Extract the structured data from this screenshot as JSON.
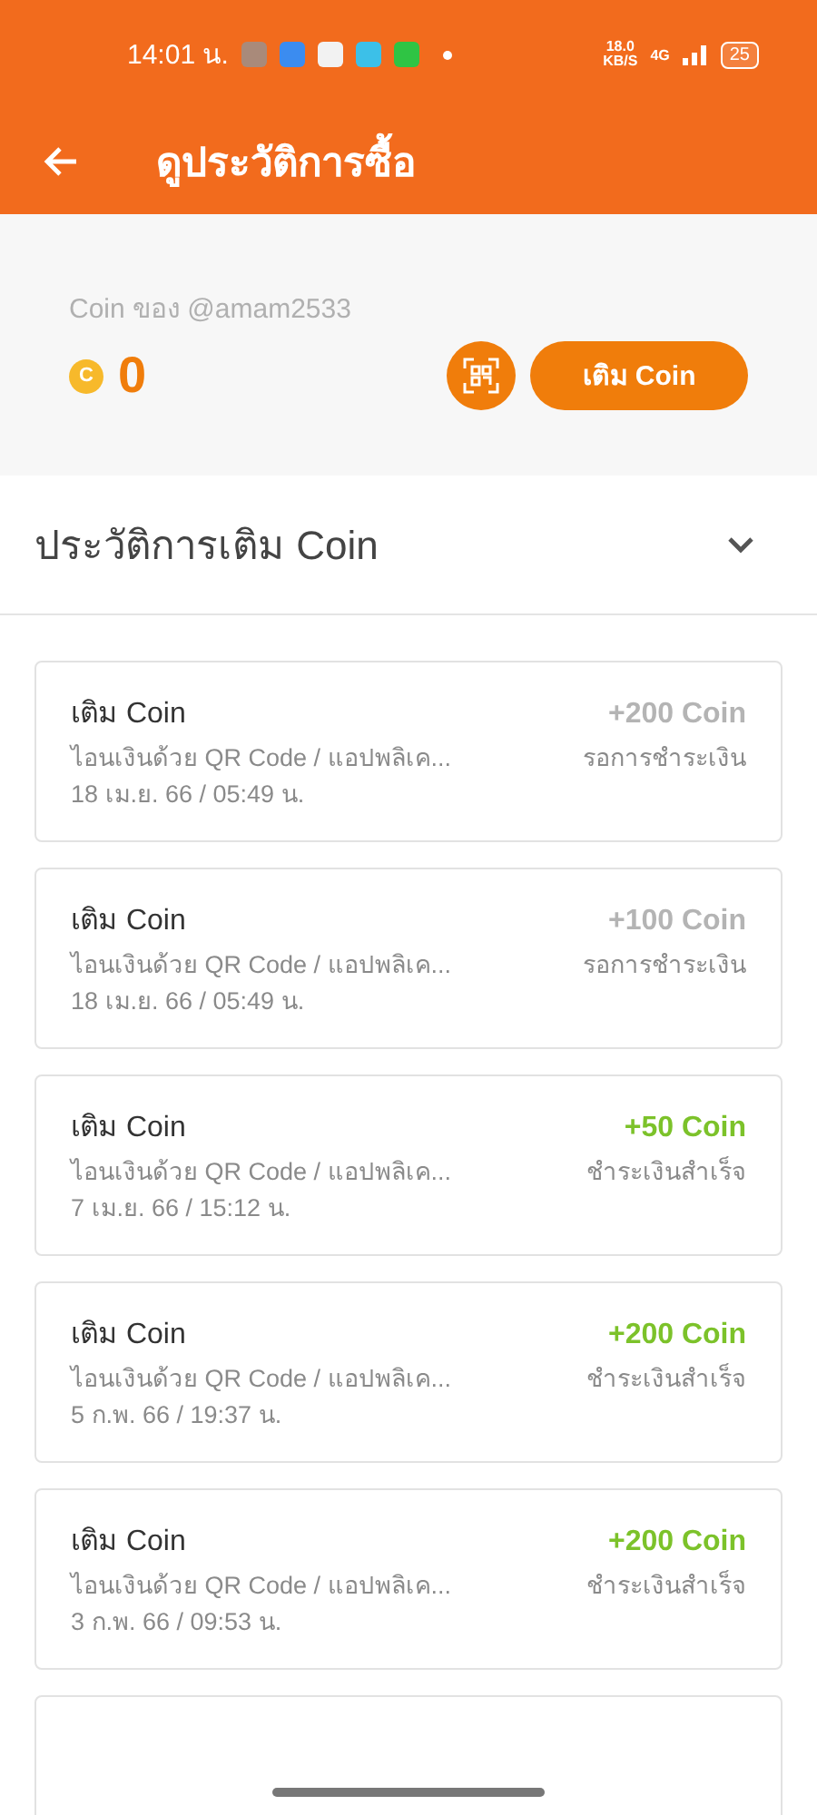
{
  "status_bar": {
    "time": "14:01 น.",
    "speed": "18.0",
    "speed_unit": "KB/S",
    "network": "4G",
    "battery": "25"
  },
  "header": {
    "title": "ดูประวัติการซื้อ"
  },
  "account": {
    "label": "Coin ของ @amam2533",
    "balance": "0",
    "coin_symbol": "C",
    "topup_button": "เติม Coin"
  },
  "section": {
    "title": "ประวัติการเติม Coin",
    "expanded": true
  },
  "transactions": [
    {
      "title": "เติม Coin",
      "amount": "+200 Coin",
      "method": "ไอนเงินด้วย QR Code / แอปพลิเค...",
      "status": "รอการชำระเงิน",
      "date": "18 เม.ย. 66 / 05:49 น.",
      "kind": "pending"
    },
    {
      "title": "เติม Coin",
      "amount": "+100 Coin",
      "method": "ไอนเงินด้วย QR Code / แอปพลิเค...",
      "status": "รอการชำระเงิน",
      "date": "18 เม.ย. 66 / 05:49 น.",
      "kind": "pending"
    },
    {
      "title": "เติม Coin",
      "amount": "+50 Coin",
      "method": "ไอนเงินด้วย QR Code / แอปพลิเค...",
      "status": "ชำระเงินสำเร็จ",
      "date": "7 เม.ย. 66 / 15:12 น.",
      "kind": "success"
    },
    {
      "title": "เติม Coin",
      "amount": "+200 Coin",
      "method": "ไอนเงินด้วย QR Code / แอปพลิเค...",
      "status": "ชำระเงินสำเร็จ",
      "date": "5 ก.พ. 66 / 19:37 น.",
      "kind": "success"
    },
    {
      "title": "เติม Coin",
      "amount": "+200 Coin",
      "method": "ไอนเงินด้วย QR Code / แอปพลิเค...",
      "status": "ชำระเงินสำเร็จ",
      "date": "3 ก.พ. 66 / 09:53 น.",
      "kind": "success"
    }
  ]
}
